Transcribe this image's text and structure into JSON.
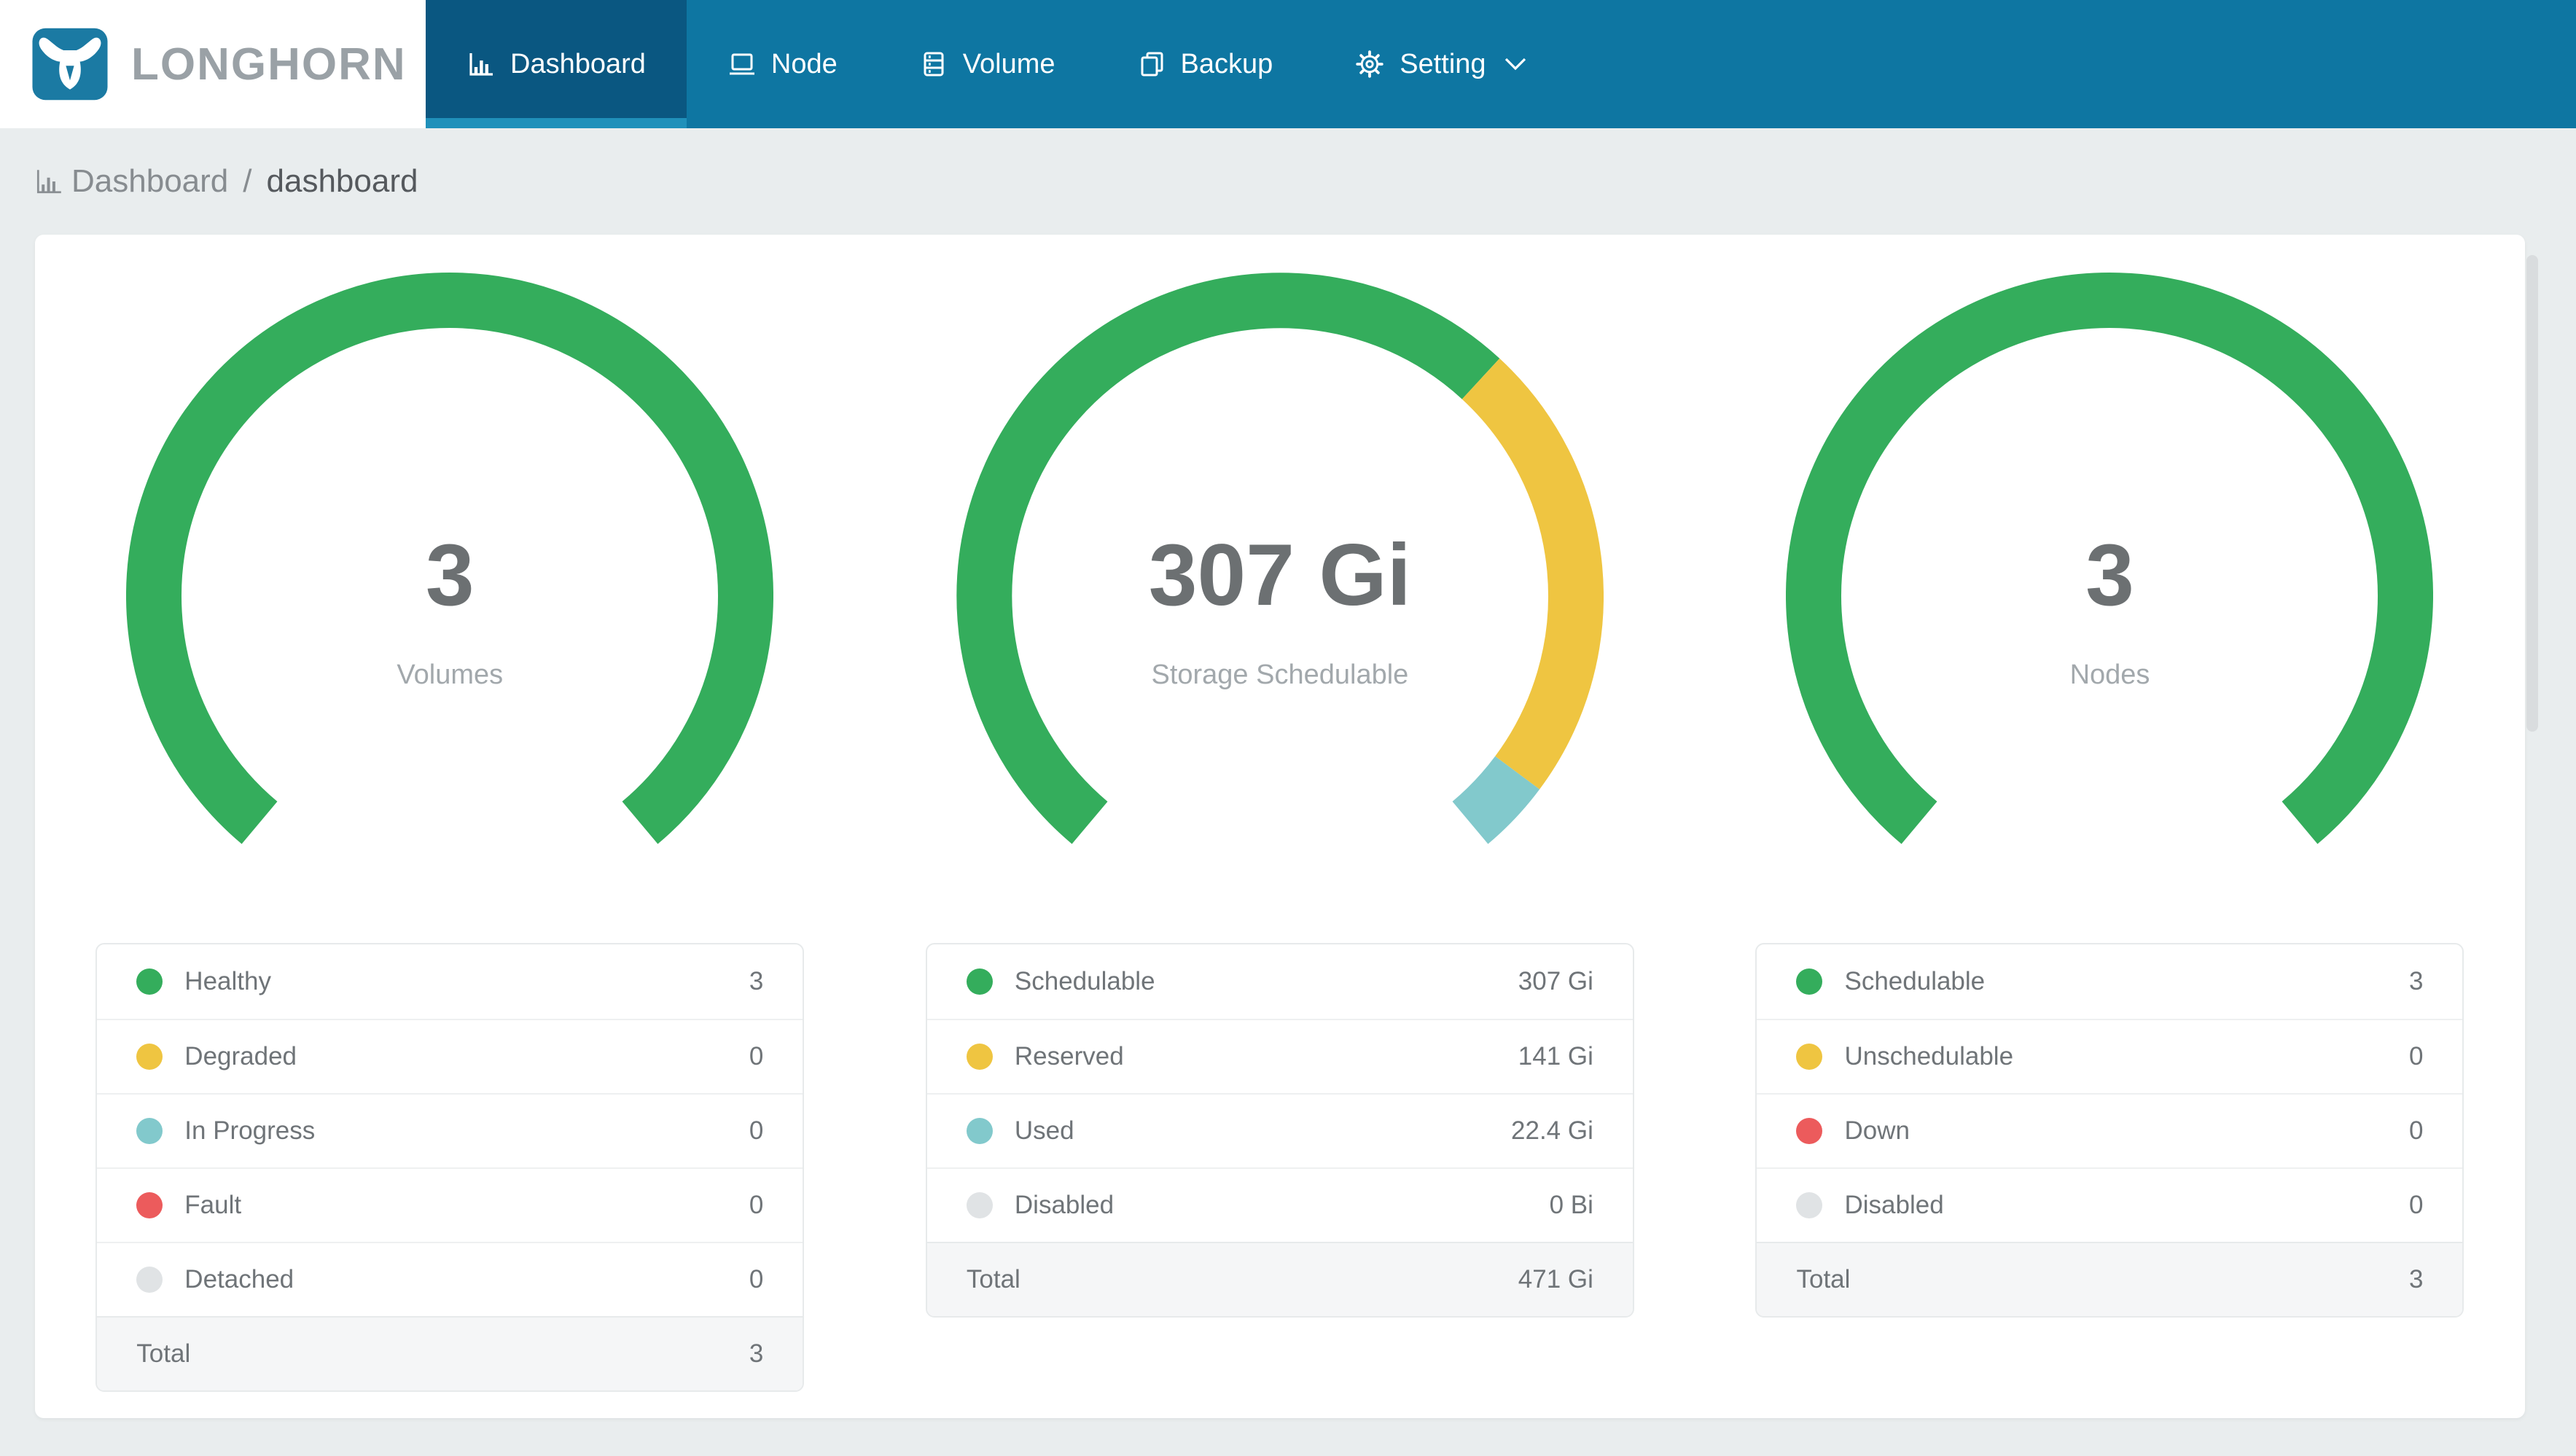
{
  "brand": {
    "name": "LONGHORN"
  },
  "colors": {
    "nav_bg": "#0e76a2",
    "nav_active_bg": "#0a5781",
    "nav_active_underline": "#2090ba",
    "page_bg": "#e9edee",
    "logo_bg": "#1b7aa3",
    "brand_text": "#9aa1a6",
    "green": "#34ad5c",
    "yellow": "#efc541",
    "teal": "#82c9cc",
    "red": "#ec5b5c",
    "gray": "#e0e3e5"
  },
  "nav": {
    "items": [
      {
        "label": "Dashboard",
        "icon": "bar-chart-icon",
        "active": true
      },
      {
        "label": "Node",
        "icon": "node-icon",
        "active": false
      },
      {
        "label": "Volume",
        "icon": "volume-icon",
        "active": false
      },
      {
        "label": "Backup",
        "icon": "backup-icon",
        "active": false
      },
      {
        "label": "Setting",
        "icon": "gear-icon",
        "active": false,
        "has_chevron": true
      }
    ]
  },
  "breadcrumb": {
    "section": "Dashboard",
    "separator": "/",
    "page": "dashboard"
  },
  "gauges": [
    {
      "center_value": "3",
      "center_label": "Volumes",
      "arc_segments": [
        {
          "amount": 3,
          "color": "#34ad5c"
        }
      ],
      "legend": [
        {
          "label": "Healthy",
          "value": "3",
          "color": "#34ad5c"
        },
        {
          "label": "Degraded",
          "value": "0",
          "color": "#efc541"
        },
        {
          "label": "In Progress",
          "value": "0",
          "color": "#82c9cc"
        },
        {
          "label": "Fault",
          "value": "0",
          "color": "#ec5b5c"
        },
        {
          "label": "Detached",
          "value": "0",
          "color": "#e0e3e5"
        }
      ],
      "total": {
        "label": "Total",
        "value": "3"
      }
    },
    {
      "center_value": "307 Gi",
      "center_label": "Storage Schedulable",
      "arc_segments": [
        {
          "amount": 307,
          "color": "#34ad5c"
        },
        {
          "amount": 141,
          "color": "#efc541"
        },
        {
          "amount": 22.4,
          "color": "#82c9cc"
        }
      ],
      "legend": [
        {
          "label": "Schedulable",
          "value": "307 Gi",
          "color": "#34ad5c"
        },
        {
          "label": "Reserved",
          "value": "141 Gi",
          "color": "#efc541"
        },
        {
          "label": "Used",
          "value": "22.4 Gi",
          "color": "#82c9cc"
        },
        {
          "label": "Disabled",
          "value": "0 Bi",
          "color": "#e0e3e5"
        }
      ],
      "total": {
        "label": "Total",
        "value": "471 Gi"
      }
    },
    {
      "center_value": "3",
      "center_label": "Nodes",
      "arc_segments": [
        {
          "amount": 3,
          "color": "#34ad5c"
        }
      ],
      "legend": [
        {
          "label": "Schedulable",
          "value": "3",
          "color": "#34ad5c"
        },
        {
          "label": "Unschedulable",
          "value": "0",
          "color": "#efc541"
        },
        {
          "label": "Down",
          "value": "0",
          "color": "#ec5b5c"
        },
        {
          "label": "Disabled",
          "value": "0",
          "color": "#e0e3e5"
        }
      ],
      "total": {
        "label": "Total",
        "value": "3"
      }
    }
  ],
  "gauge_geometry": {
    "start_angle_deg": 130,
    "sweep_deg": 280,
    "stroke_width": 38,
    "mid_radius": 203
  }
}
